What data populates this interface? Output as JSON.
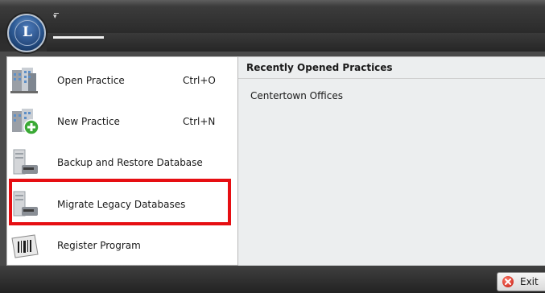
{
  "app": {
    "orb_letter": "L",
    "qat_glyph": "▾"
  },
  "menu": {
    "items": [
      {
        "label": "Open Practice",
        "shortcut": "Ctrl+O",
        "icon": "building-icon"
      },
      {
        "label": "New Practice",
        "shortcut": "Ctrl+N",
        "icon": "building-add-icon"
      },
      {
        "label": "Backup and Restore Database",
        "shortcut": "",
        "icon": "server-icon"
      },
      {
        "label": "Migrate Legacy Databases",
        "shortcut": "",
        "icon": "server-icon"
      },
      {
        "label": "Register Program",
        "shortcut": "",
        "icon": "barcode-icon"
      }
    ]
  },
  "recent": {
    "header": "Recently Opened Practices",
    "entries": [
      "Centertown Offices"
    ]
  },
  "footer": {
    "exit_label": "Exit"
  },
  "colors": {
    "highlight": "#e60e12",
    "accent": "#2e5c97"
  }
}
